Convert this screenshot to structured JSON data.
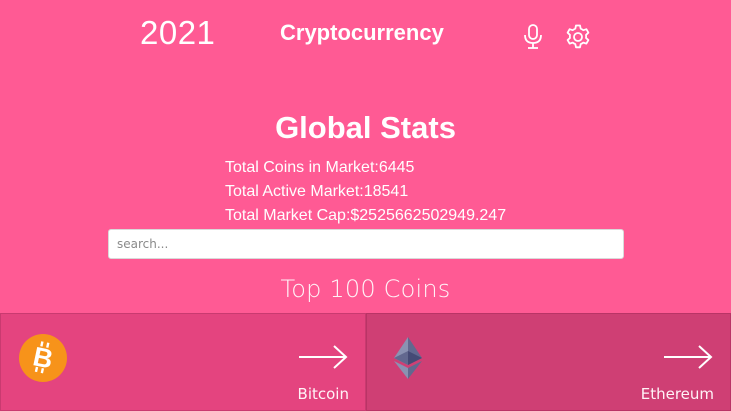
{
  "header": {
    "year": "2021",
    "title": "Cryptocurrency",
    "icons": [
      "microphone-icon",
      "gear-icon"
    ]
  },
  "stats": {
    "title": "Global Stats",
    "total_coins": "Total Coins in Market:6445",
    "total_active_market": "Total Active Market:18541",
    "total_market_cap": "Total Market Cap:$2525662502949.247"
  },
  "search": {
    "placeholder": "search...",
    "value": ""
  },
  "coins_section": {
    "title": "Top 100 Coins",
    "coins": [
      {
        "name": "Bitcoin",
        "icon": "bitcoin-logo-icon",
        "color": "#f7931a"
      },
      {
        "name": "Ethereum",
        "icon": "ethereum-logo-icon",
        "color": "#627eea"
      }
    ]
  },
  "colors": {
    "background": "#ff5a94",
    "card_bitcoin": "#e4447f",
    "card_ethereum": "#cf3f74",
    "text": "#ffffff"
  }
}
